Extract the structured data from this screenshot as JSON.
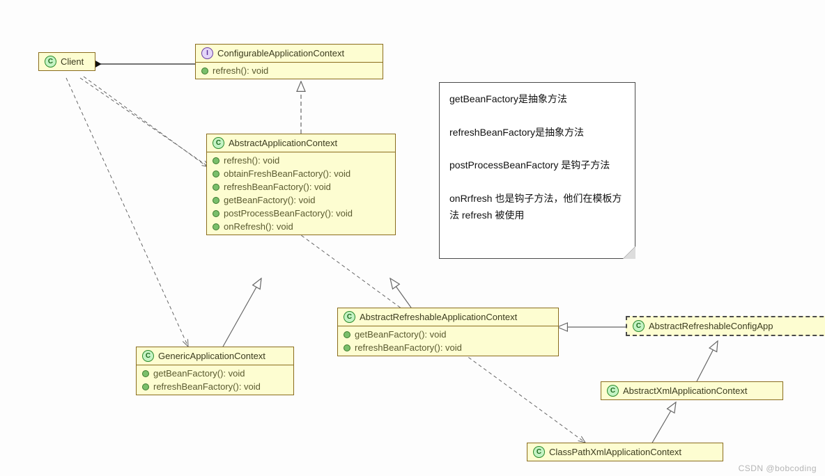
{
  "boxes": {
    "client": {
      "title": "Client",
      "kind": "class",
      "members": []
    },
    "configCtx": {
      "title": "ConfigurableApplicationContext",
      "kind": "interface",
      "members": [
        "refresh(): void"
      ]
    },
    "abstractCtx": {
      "title": "AbstractApplicationContext",
      "kind": "class",
      "members": [
        "refresh(): void",
        "obtainFreshBeanFactory(): void",
        "refreshBeanFactory(): void",
        "getBeanFactory(): void",
        "postProcessBeanFactory(): void",
        "onRefresh(): void"
      ]
    },
    "genericCtx": {
      "title": "GenericApplicationContext",
      "kind": "class",
      "members": [
        "getBeanFactory(): void",
        "refreshBeanFactory(): void"
      ]
    },
    "absRefreshCtx": {
      "title": "AbstractRefreshableApplicationContext",
      "kind": "class",
      "members": [
        "getBeanFactory(): void",
        "refreshBeanFactory(): void"
      ]
    },
    "absRefreshConfig": {
      "title": "AbstractRefreshableConfigApp",
      "kind": "class",
      "members": []
    },
    "absXmlCtx": {
      "title": "AbstractXmlApplicationContext",
      "kind": "class",
      "members": []
    },
    "cpXmlCtx": {
      "title": "ClassPathXmlApplicationContext",
      "kind": "class",
      "members": []
    }
  },
  "note": {
    "line1": "getBeanFactory是抽象方法",
    "line2": "refreshBeanFactory是抽象方法",
    "line3": "postProcessBeanFactory 是钩子方法",
    "line4": "onRrfresh 也是钩子方法，他们在模板方法 refresh 被使用"
  },
  "watermark": "CSDN @bobcoding"
}
